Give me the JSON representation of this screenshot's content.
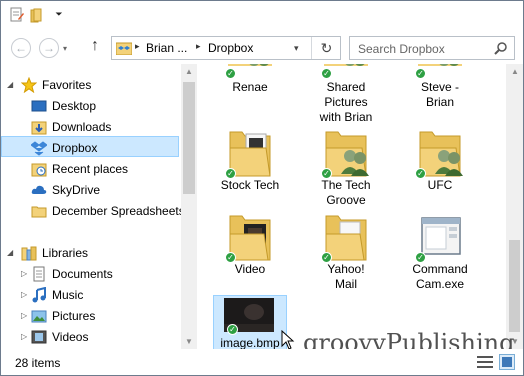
{
  "quick_access": {
    "dropdown_glyph": "⏷"
  },
  "toolbar": {
    "back_glyph": "←",
    "forward_glyph": "→",
    "recent_glyph": "▾",
    "up_glyph": "↑"
  },
  "address": {
    "crumbs": [
      "Brian ...",
      "Dropbox"
    ],
    "separator": "▸",
    "dropdown_glyph": "▾",
    "refresh_glyph": "↻"
  },
  "search": {
    "placeholder": "Search Dropbox"
  },
  "nav": {
    "favorites": {
      "label": "Favorites",
      "items": [
        "Desktop",
        "Downloads",
        "Dropbox",
        "Recent places",
        "SkyDrive",
        "December Spreadsheets"
      ],
      "selected": "Dropbox"
    },
    "libraries": {
      "label": "Libraries",
      "items": [
        "Documents",
        "Music",
        "Pictures",
        "Videos"
      ]
    },
    "collapse_glyph": "◢",
    "expand_glyph": "▷"
  },
  "files": [
    {
      "name": "Renae",
      "type": "shared-folder"
    },
    {
      "name": "Shared Pictures with Brian",
      "type": "shared-folder"
    },
    {
      "name": "Steve - Brian",
      "type": "shared-folder"
    },
    {
      "name": "Stock Tech",
      "type": "folder"
    },
    {
      "name": "The Tech Groove",
      "type": "shared-folder"
    },
    {
      "name": "UFC",
      "type": "shared-folder"
    },
    {
      "name": "Video",
      "type": "folder"
    },
    {
      "name": "Yahoo! Mail",
      "type": "folder"
    },
    {
      "name": "Command Cam.exe",
      "type": "application"
    },
    {
      "name": "image.bmp",
      "type": "image",
      "selected": true
    }
  ],
  "status": {
    "count": "28 items"
  },
  "watermark": "groovyPublishing",
  "colors": {
    "accent": "#cce8ff",
    "accent_border": "#99d1ff",
    "sync_check": "#2ea043",
    "folder": "#f3d27a"
  }
}
